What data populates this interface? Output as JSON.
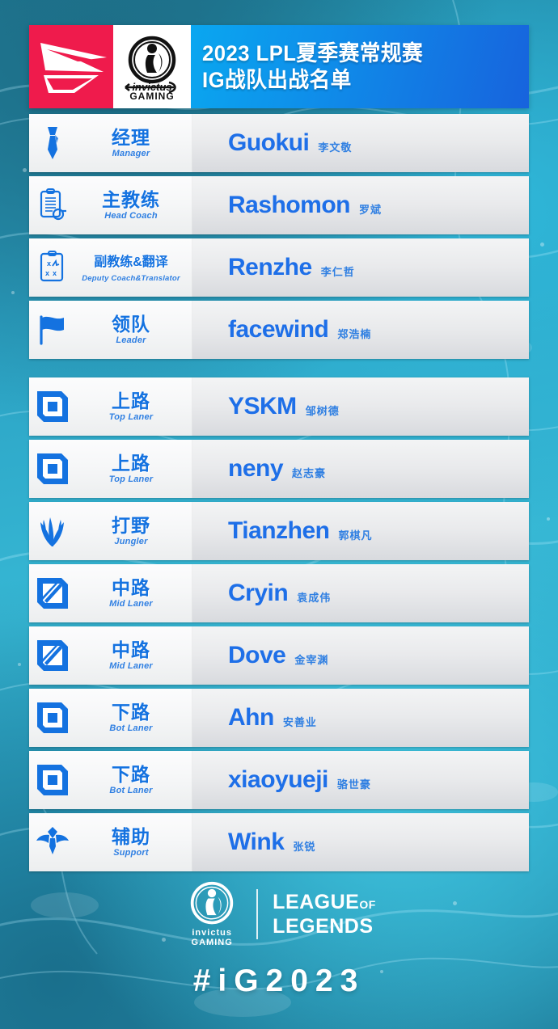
{
  "header": {
    "lpl_logo": "lpl-logo",
    "ig_logo": "ig-logo",
    "title_line1": "2023 LPL夏季赛常规赛",
    "title_line2": "IG战队出战名单"
  },
  "staff": [
    {
      "icon": "necktie-icon",
      "role_cn": "经理",
      "role_en": "Manager",
      "id": "Guokui",
      "name": "李文敬",
      "small": false
    },
    {
      "icon": "clipboard-icon",
      "role_cn": "主教练",
      "role_en": "Head Coach",
      "id": "Rashomon",
      "name": "罗斌",
      "small": false
    },
    {
      "icon": "clipboard-tactics-icon",
      "role_cn": "副教练&翻译",
      "role_en": "Deputy Coach&Translator",
      "id": "Renzhe",
      "name": "李仁哲",
      "small": true
    },
    {
      "icon": "flag-icon",
      "role_cn": "领队",
      "role_en": "Leader",
      "id": "facewind",
      "name": "郑浩楠",
      "small": false
    }
  ],
  "players": [
    {
      "icon": "top-lane-icon",
      "role_cn": "上路",
      "role_en": "Top Laner",
      "id": "YSKM",
      "name": "邹树德",
      "small": false
    },
    {
      "icon": "top-lane-icon",
      "role_cn": "上路",
      "role_en": "Top Laner",
      "id": "neny",
      "name": "赵志豪",
      "small": false
    },
    {
      "icon": "jungle-icon",
      "role_cn": "打野",
      "role_en": "Jungler",
      "id": "Tianzhen",
      "name": "郭棋凡",
      "small": false
    },
    {
      "icon": "mid-lane-icon",
      "role_cn": "中路",
      "role_en": "Mid Laner",
      "id": "Cryin",
      "name": "袁成伟",
      "small": false
    },
    {
      "icon": "mid-lane-icon",
      "role_cn": "中路",
      "role_en": "Mid Laner",
      "id": "Dove",
      "name": "金宰渊",
      "small": false
    },
    {
      "icon": "bot-lane-icon",
      "role_cn": "下路",
      "role_en": "Bot Laner",
      "id": "Ahn",
      "name": "安善业",
      "small": false
    },
    {
      "icon": "bot-lane-icon",
      "role_cn": "下路",
      "role_en": "Bot Laner",
      "id": "xiaoyueji",
      "name": "骆世豪",
      "small": false
    },
    {
      "icon": "support-icon",
      "role_cn": "辅助",
      "role_en": "Support",
      "id": "Wink",
      "name": "张锐",
      "small": false
    }
  ],
  "footer": {
    "ig_word_line1": "invictus",
    "ig_word_line2": "GAMING",
    "lol_line1": "LEAGUE",
    "lol_of": "OF",
    "lol_line2": "LEGENDS",
    "hashtag": "#iG2023"
  },
  "colors": {
    "lpl_red": "#ef1b4c",
    "accent_blue": "#1e6fe8",
    "role_blue": "#1472e0",
    "title_gradient_start": "#0aa7f0",
    "title_gradient_end": "#1763dd",
    "background_teal": "#2ba2c4",
    "panel_light": "#f6f7f8",
    "panel_grey": "#e3e5e8"
  }
}
